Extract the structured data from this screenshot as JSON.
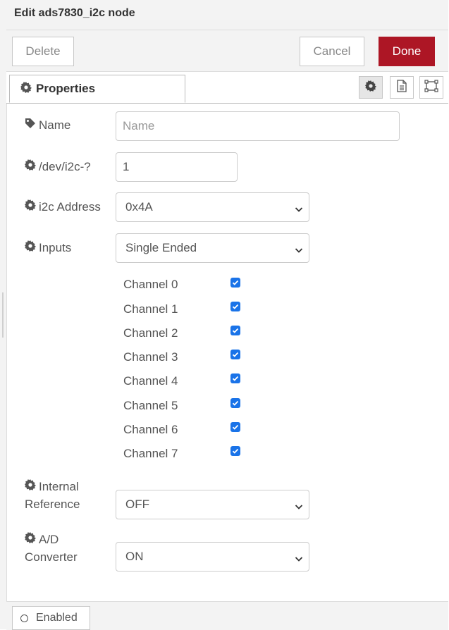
{
  "header": {
    "title": "Edit ads7830_i2c node"
  },
  "toolbar": {
    "delete_label": "Delete",
    "cancel_label": "Cancel",
    "done_label": "Done"
  },
  "tabs": [
    {
      "label": "Properties",
      "icon": "gear-icon"
    }
  ],
  "tab_icons": [
    "gear-icon",
    "document-icon",
    "frame-icon"
  ],
  "form": {
    "name": {
      "label": "Name",
      "placeholder": "Name",
      "value": "",
      "icon": "tag-icon"
    },
    "device": {
      "label": "/dev/i2c-?",
      "value": "1",
      "icon": "gear-icon"
    },
    "address": {
      "label": "i2c Address",
      "value": "0x4A",
      "icon": "gear-icon"
    },
    "inputs": {
      "label": "Inputs",
      "value": "Single Ended",
      "icon": "gear-icon"
    },
    "channels": [
      {
        "label": "Channel 0",
        "checked": true
      },
      {
        "label": "Channel 1",
        "checked": true
      },
      {
        "label": "Channel 2",
        "checked": true
      },
      {
        "label": "Channel 3",
        "checked": true
      },
      {
        "label": "Channel 4",
        "checked": true
      },
      {
        "label": "Channel 5",
        "checked": true
      },
      {
        "label": "Channel 6",
        "checked": true
      },
      {
        "label": "Channel 7",
        "checked": true
      }
    ],
    "internal_reference": {
      "label_line1": "Internal",
      "label_line2": "Reference",
      "value": "OFF",
      "icon": "gear-icon"
    },
    "ad_converter": {
      "label_line1": "A/D",
      "label_line2": "Converter",
      "value": "ON",
      "icon": "gear-icon"
    }
  },
  "footer": {
    "enabled_label": "Enabled"
  },
  "colors": {
    "done_bg": "#AD1625",
    "checkbox": "#1a73e8"
  }
}
